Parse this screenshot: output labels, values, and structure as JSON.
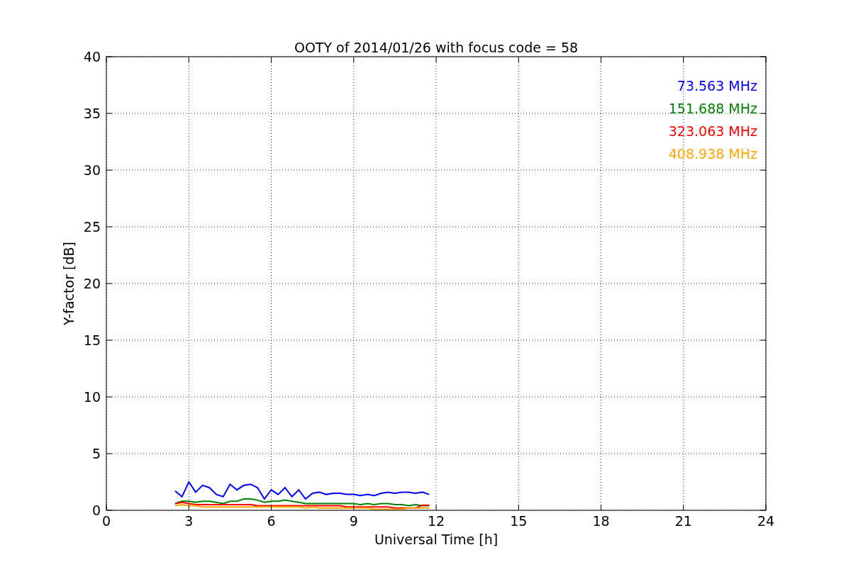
{
  "figure": {
    "chart_data": {
      "type": "line",
      "title": "OOTY of 2014/01/26 with focus code = 58",
      "xlabel": "Universal Time [h]",
      "ylabel": "Y-factor [dB]",
      "x": [
        2.5,
        2.75,
        3.0,
        3.25,
        3.5,
        3.75,
        4.0,
        4.25,
        4.5,
        4.75,
        5.0,
        5.25,
        5.5,
        5.75,
        6.0,
        6.25,
        6.5,
        6.75,
        7.0,
        7.25,
        7.5,
        7.75,
        8.0,
        8.25,
        8.5,
        8.75,
        9.0,
        9.25,
        9.5,
        9.75,
        10.0,
        10.25,
        10.5,
        10.75,
        11.0,
        11.25,
        11.5,
        11.75
      ],
      "series": [
        {
          "name": "73.563 MHz",
          "color": "#0000ff",
          "values": [
            1.7,
            1.2,
            2.5,
            1.6,
            2.2,
            2.0,
            1.4,
            1.2,
            2.3,
            1.8,
            2.2,
            2.3,
            2.0,
            1.0,
            1.8,
            1.4,
            2.0,
            1.2,
            1.8,
            1.0,
            1.5,
            1.6,
            1.4,
            1.5,
            1.5,
            1.4,
            1.4,
            1.3,
            1.4,
            1.3,
            1.5,
            1.6,
            1.5,
            1.6,
            1.6,
            1.5,
            1.6,
            1.4
          ]
        },
        {
          "name": "151.688 MHz",
          "color": "#008000",
          "values": [
            0.6,
            0.8,
            0.8,
            0.7,
            0.8,
            0.8,
            0.7,
            0.6,
            0.8,
            0.8,
            1.0,
            1.0,
            0.9,
            0.7,
            0.8,
            0.8,
            0.9,
            0.8,
            0.7,
            0.6,
            0.6,
            0.6,
            0.6,
            0.6,
            0.6,
            0.6,
            0.6,
            0.5,
            0.6,
            0.5,
            0.6,
            0.6,
            0.5,
            0.5,
            0.4,
            0.5,
            0.4,
            0.4
          ]
        },
        {
          "name": "323.063 MHz",
          "color": "#ff0000",
          "values": [
            0.6,
            0.7,
            0.6,
            0.5,
            0.5,
            0.5,
            0.5,
            0.5,
            0.5,
            0.5,
            0.5,
            0.5,
            0.4,
            0.4,
            0.4,
            0.4,
            0.4,
            0.4,
            0.4,
            0.4,
            0.4,
            0.4,
            0.4,
            0.4,
            0.4,
            0.3,
            0.3,
            0.3,
            0.3,
            0.3,
            0.3,
            0.3,
            0.2,
            0.2,
            0.2,
            0.2,
            0.45,
            0.45
          ]
        },
        {
          "name": "408.938 MHz",
          "color": "#ffa500",
          "values": [
            0.4,
            0.5,
            0.4,
            0.4,
            0.3,
            0.3,
            0.3,
            0.3,
            0.3,
            0.3,
            0.3,
            0.3,
            0.3,
            0.3,
            0.3,
            0.3,
            0.3,
            0.3,
            0.3,
            0.2,
            0.3,
            0.2,
            0.2,
            0.2,
            0.2,
            0.2,
            0.2,
            0.2,
            0.2,
            0.1,
            0.1,
            0.1,
            0.1,
            0.1,
            0.2,
            0.2,
            0.2,
            0.2
          ]
        }
      ],
      "xlim": [
        0,
        24
      ],
      "ylim": [
        0,
        40
      ],
      "xticks": [
        0,
        3,
        6,
        9,
        12,
        15,
        18,
        21,
        24
      ],
      "yticks": [
        0,
        5,
        10,
        15,
        20,
        25,
        30,
        35,
        40
      ],
      "grid": true
    }
  }
}
